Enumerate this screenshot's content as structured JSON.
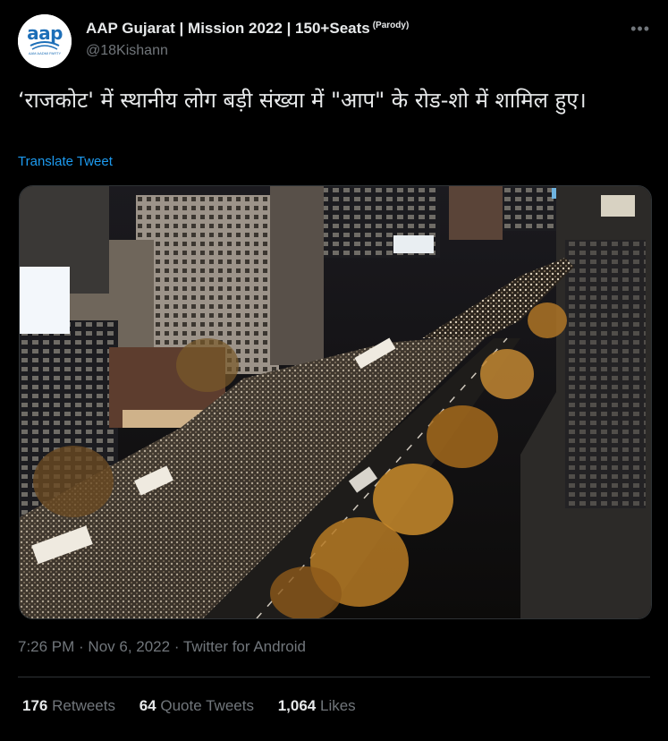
{
  "author": {
    "display_name": "AAP Gujarat | Mission 2022 | 150+Seats",
    "parody_tag": "(Parody)",
    "handle": "@18Kishann",
    "avatar_text": "aap",
    "avatar_subtext": "AAM AADMI PARTY"
  },
  "more_icon": "more-horizontal-icon",
  "tweet": {
    "text": "‘राजकोट' में स्थानीय लोग बड़ी संख्या में \"आप\" के रोड-शो में शामिल हुए।",
    "translate_label": "Translate Tweet"
  },
  "meta": {
    "time": "7:26 PM",
    "separator": " · ",
    "date": "Nov 6, 2022",
    "source": "Twitter for Android"
  },
  "stats": {
    "retweets_count": "176",
    "retweets_label": "Retweets",
    "quotes_count": "64",
    "quotes_label": "Quote Tweets",
    "likes_count": "1,064",
    "likes_label": "Likes"
  },
  "colors": {
    "background": "#000000",
    "text_primary": "#e7e9ea",
    "text_secondary": "#71767b",
    "link": "#1d9bf0",
    "divider": "#2f3336",
    "avatar_brand": "#1d6fb8"
  }
}
